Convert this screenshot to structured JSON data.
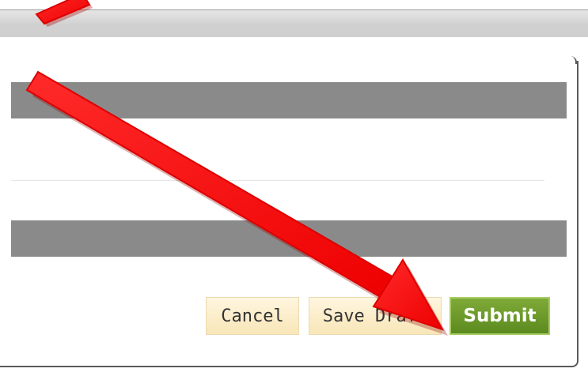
{
  "actions": {
    "cancel_label": "Cancel",
    "save_draft_label": "Save Draft",
    "submit_label": "Submit"
  },
  "colors": {
    "section_bar": "#8a8a8a",
    "neutral_button": "#f8e6b8",
    "submit_button": "#6b9a2a",
    "annotation_arrow": "#ff0000"
  },
  "annotations": {
    "arrow_icon": "red-arrow-icon"
  }
}
